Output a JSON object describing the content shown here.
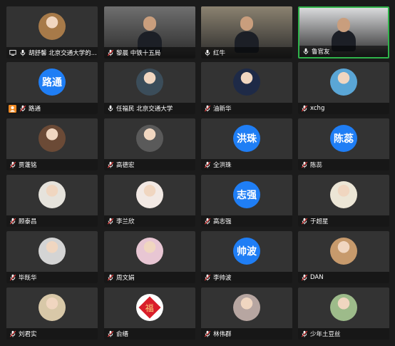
{
  "meeting": {
    "participants": [
      {
        "name": "胡舒馨 北京交通大学的...",
        "avatar_type": "photo",
        "avatar_color": "#a77a49",
        "mic": "on",
        "screen_share_icon": true
      },
      {
        "name": "黎晨 中铁十五局",
        "avatar_type": "video",
        "avatar_color": "#6f6f6f",
        "mic": "muted"
      },
      {
        "name": "红牛",
        "avatar_type": "video",
        "avatar_color": "#8b8270",
        "mic": "on"
      },
      {
        "name": "鲁官友",
        "avatar_type": "video",
        "avatar_color": "#d9dadc",
        "mic": "on",
        "active_speaker": true
      },
      {
        "name": "路通",
        "avatar_type": "text",
        "avatar_text": "路通",
        "mic": "muted",
        "user_icon": true
      },
      {
        "name": "任福民 北京交通大学",
        "avatar_type": "photo",
        "avatar_color": "#3b4d5a",
        "mic": "on"
      },
      {
        "name": "油新华",
        "avatar_type": "photo",
        "avatar_color": "#1e2a47",
        "mic": "muted"
      },
      {
        "name": "xchg",
        "avatar_type": "photo",
        "avatar_color": "#5aa6d6",
        "mic": "muted"
      },
      {
        "name": "贾蓬铭",
        "avatar_type": "photo",
        "avatar_color": "#6b4a36",
        "mic": "muted"
      },
      {
        "name": "高德宏",
        "avatar_type": "photo",
        "avatar_color": "#5a5a5a",
        "mic": "muted"
      },
      {
        "name": "全洪珠",
        "avatar_type": "text",
        "avatar_text": "洪珠",
        "mic": "muted"
      },
      {
        "name": "陈蕊",
        "avatar_type": "text",
        "avatar_text": "陈蕊",
        "mic": "muted"
      },
      {
        "name": "顾泰昌",
        "avatar_type": "photo",
        "avatar_color": "#e6e3dc",
        "mic": "muted"
      },
      {
        "name": "李兰欣",
        "avatar_type": "photo",
        "avatar_color": "#f2e9e4",
        "mic": "muted"
      },
      {
        "name": "高志强",
        "avatar_type": "text",
        "avatar_text": "志强",
        "mic": "muted"
      },
      {
        "name": "于超星",
        "avatar_type": "photo",
        "avatar_color": "#ece6d6",
        "mic": "muted"
      },
      {
        "name": "毕既华",
        "avatar_type": "photo",
        "avatar_color": "#d4d4d4",
        "mic": "muted"
      },
      {
        "name": "周文娟",
        "avatar_type": "photo",
        "avatar_color": "#e8c6d3",
        "mic": "muted"
      },
      {
        "name": "李帅波",
        "avatar_type": "text",
        "avatar_text": "帅波",
        "mic": "muted"
      },
      {
        "name": "DAN",
        "avatar_type": "photo",
        "avatar_color": "#c79a6c",
        "mic": "muted"
      },
      {
        "name": "刘君实",
        "avatar_type": "photo",
        "avatar_color": "#d8c8a8",
        "mic": "muted"
      },
      {
        "name": "俞缙",
        "avatar_type": "photo",
        "avatar_color": "#ffffff",
        "mic": "muted",
        "badge_text": "福"
      },
      {
        "name": "林伟群",
        "avatar_type": "photo",
        "avatar_color": "#b7a6a1",
        "mic": "muted"
      },
      {
        "name": "少年土豆丝",
        "avatar_type": "photo",
        "avatar_color": "#9dbb8a",
        "mic": "muted"
      }
    ]
  }
}
